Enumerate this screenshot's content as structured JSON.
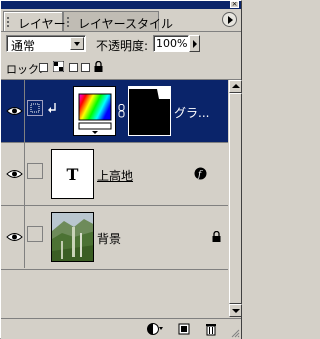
{
  "tabs": [
    {
      "label": "レイヤー",
      "active": true
    },
    {
      "label": "レイヤースタイル",
      "active": false
    }
  ],
  "blend_mode": {
    "value": "通常"
  },
  "opacity": {
    "label": "不透明度:",
    "value": "100%"
  },
  "lock": {
    "label": "ロック:"
  },
  "layers": [
    {
      "name": "グラ...",
      "selected": true,
      "visible": true,
      "type": "gradient-fill-with-mask"
    },
    {
      "name": "上高地",
      "selected": false,
      "visible": true,
      "type": "text",
      "thumb_letter": "T"
    },
    {
      "name": "背景",
      "selected": false,
      "visible": true,
      "type": "image",
      "locked": true
    }
  ],
  "colors": {
    "panel_bg": "#d4d0c8",
    "selection": "#0a246a",
    "titlebar": "#0a246a"
  },
  "icons": {
    "visibility": "eye-icon",
    "lock_transparent": "checkerboard-icon",
    "lock_all": "padlock-icon",
    "text_effects": "f-effect-icon",
    "background_lock": "padlock-icon",
    "adjustment_layer": "half-circle-icon",
    "new_layer": "new-layer-icon",
    "delete_layer": "trash-icon",
    "palette_menu": "menu-arrow-icon"
  }
}
